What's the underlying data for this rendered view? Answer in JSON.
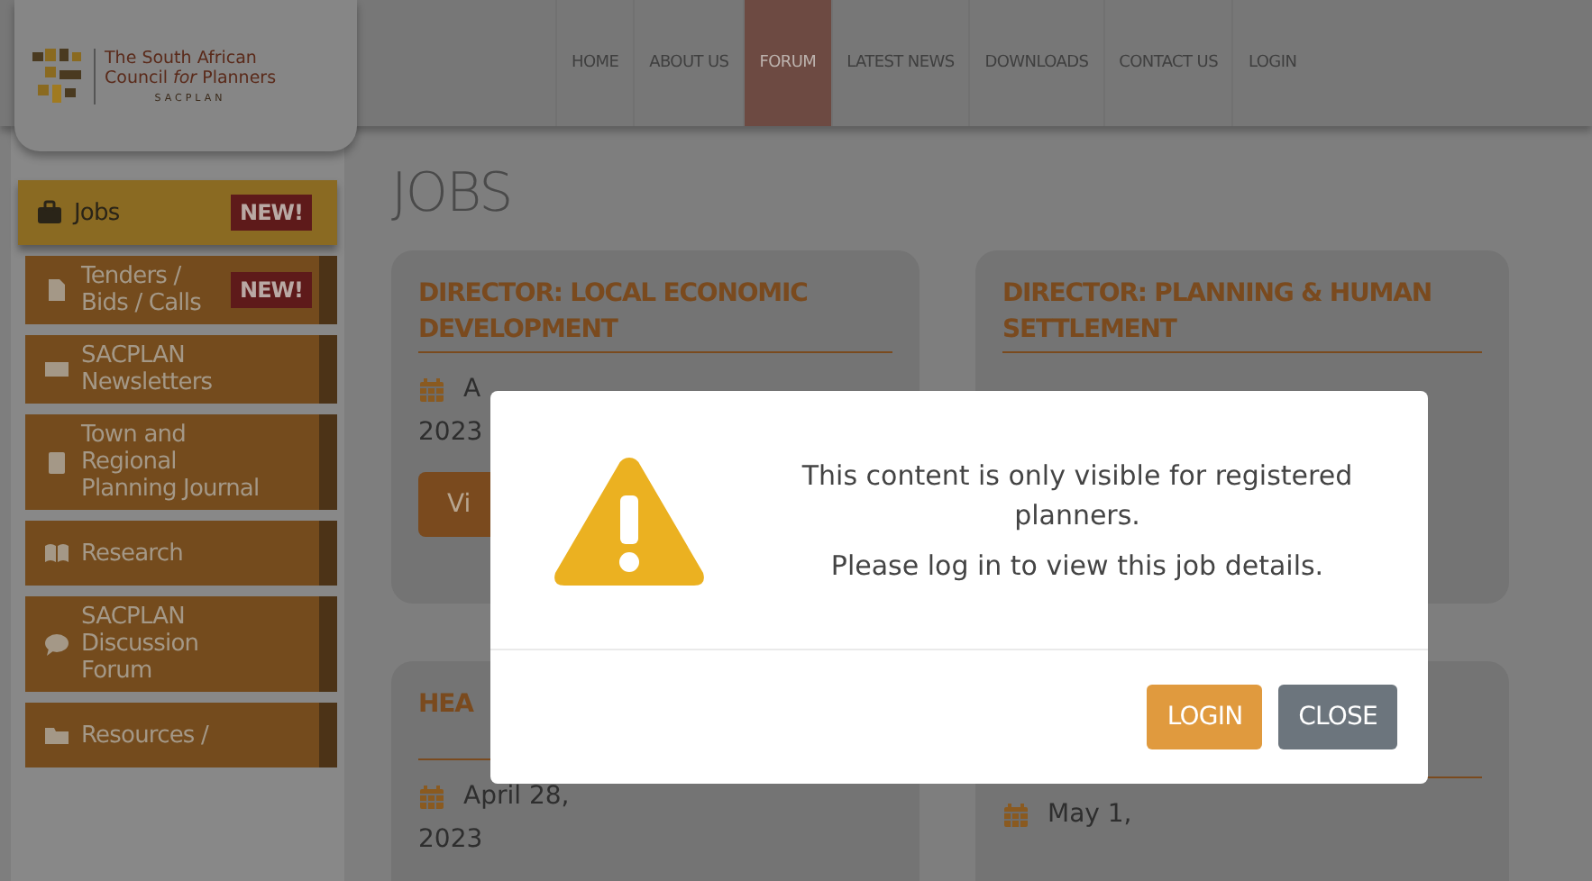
{
  "logo": {
    "line1": "The South African",
    "line2": "Council *for* Planners",
    "acronym": "SACPLAN"
  },
  "nav": [
    {
      "label": "HOME",
      "selected": false
    },
    {
      "label": "ABOUT US",
      "selected": false
    },
    {
      "label": "FORUM",
      "selected": true
    },
    {
      "label": "LATEST NEWS",
      "selected": false
    },
    {
      "label": "DOWNLOADS",
      "selected": false
    },
    {
      "label": "CONTACT US",
      "selected": false
    },
    {
      "label": "LOGIN",
      "selected": false
    }
  ],
  "sidebar": [
    {
      "label": "Jobs",
      "badge": "NEW!",
      "selected": true
    },
    {
      "label": "Tenders / Bids / Calls",
      "badge": "NEW!",
      "selected": false
    },
    {
      "label": "SACPLAN Newsletters",
      "selected": false
    },
    {
      "label": "Town and Regional Planning Journal",
      "selected": false
    },
    {
      "label": "Research",
      "selected": false
    },
    {
      "label": "SACPLAN Discussion Forum",
      "selected": false
    },
    {
      "label": "Resources /",
      "selected": false
    }
  ],
  "page_title": "JOBS",
  "jobs": [
    {
      "title": "DIRECTOR: LOCAL ECONOMIC DEVELOPMENT",
      "date": "A",
      "year": "2023",
      "button": "Vi"
    },
    {
      "title": "DIRECTOR: PLANNING & HUMAN SETTLEMENT"
    },
    {
      "title": "HEA",
      "date": "April 28,",
      "year": "2023"
    },
    {
      "date": "May 1,"
    }
  ],
  "modal": {
    "message": "This content is only visible for registered planners.",
    "note": "Please log in to view this job details.",
    "buttons": [
      {
        "label": "LOGIN",
        "kind": "primary"
      },
      {
        "label": "CLOSE",
        "kind": "secondary"
      }
    ]
  }
}
